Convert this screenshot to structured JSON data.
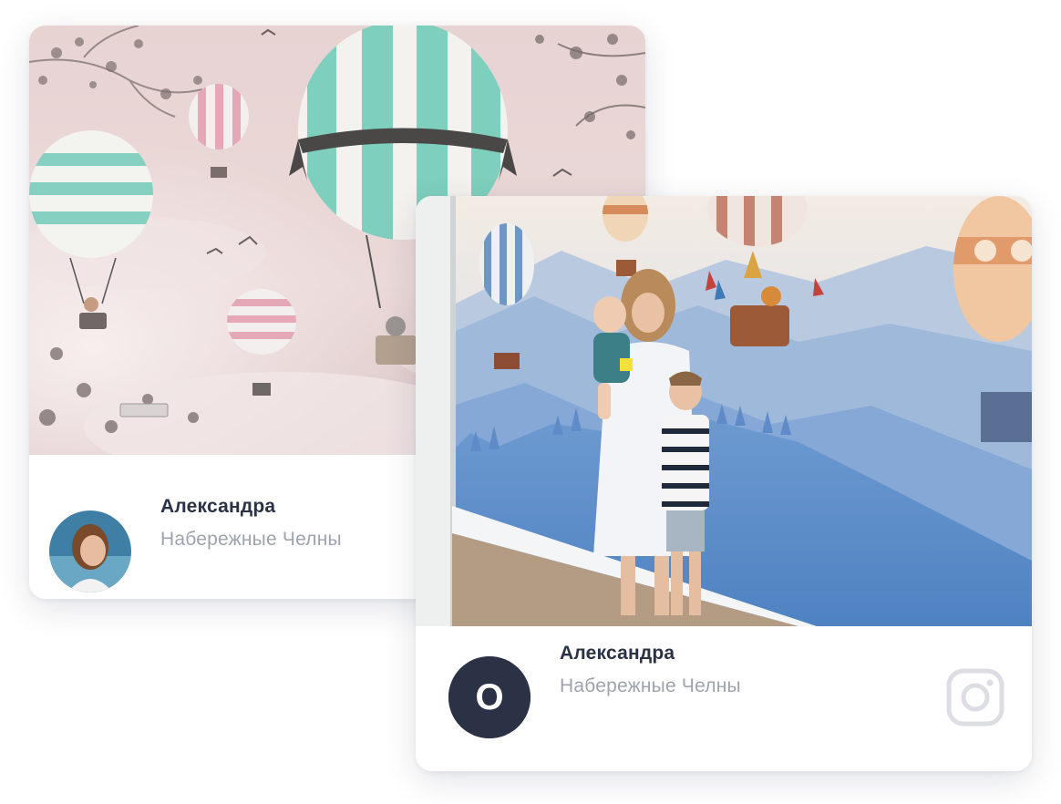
{
  "reviews": [
    {
      "name": "Александра",
      "city": "Набережные Челны",
      "photo_icon": "hot-air-balloons-pink-mural-photo",
      "avatar_icon": "avatar-photo"
    },
    {
      "name": "Александра",
      "city": "Набережные Челны",
      "photo_icon": "family-hot-air-balloons-mural-photo",
      "avatar_letter": "O",
      "social_icon": "instagram-icon"
    }
  ],
  "colors": {
    "name_text": "#2b3246",
    "city_text": "#9ea3ad",
    "avatar_dark": "#2b3246",
    "instagram_icon": "#dcdee3"
  }
}
